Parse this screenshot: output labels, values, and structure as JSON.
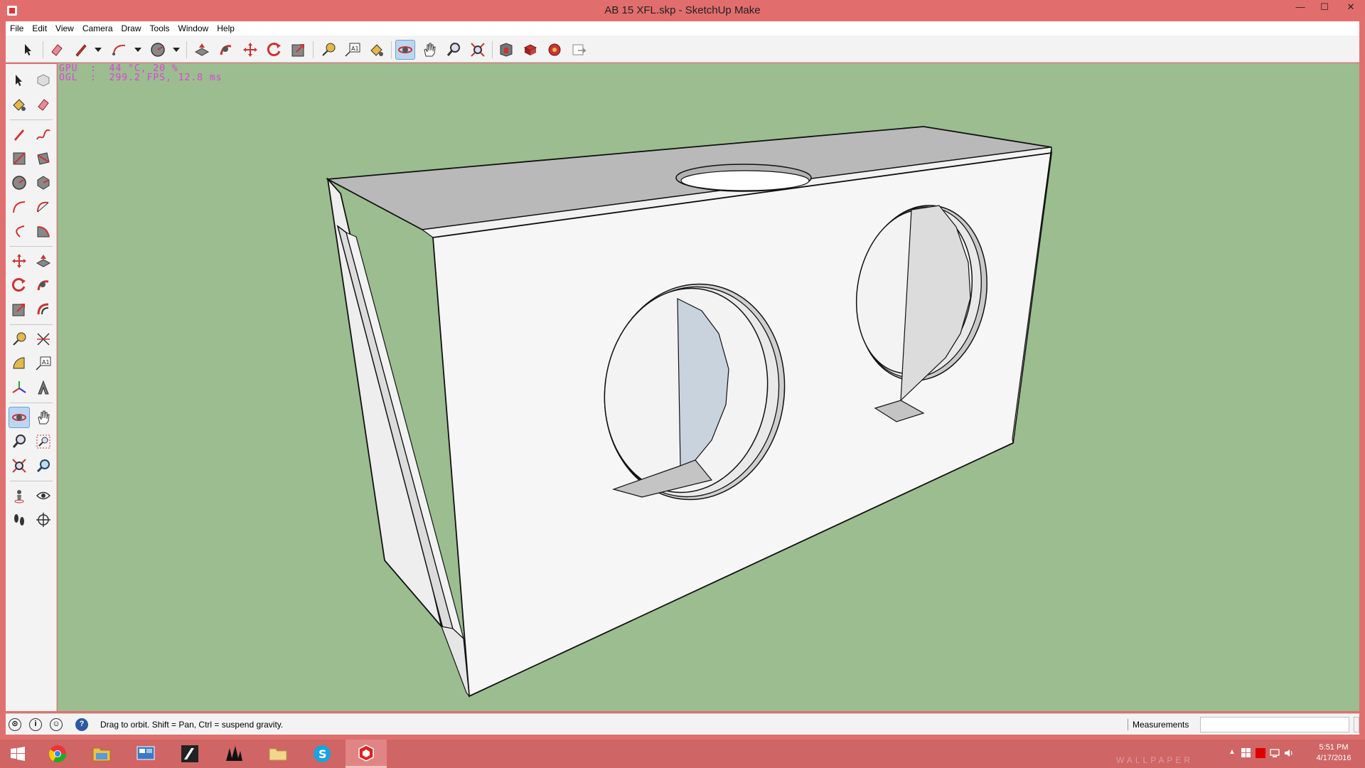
{
  "window": {
    "title": "AB 15 XFL.skp - SketchUp Make",
    "min_glyph": "—",
    "max_glyph": "☐",
    "close_glyph": "✕"
  },
  "menu": [
    "File",
    "Edit",
    "View",
    "Camera",
    "Draw",
    "Tools",
    "Window",
    "Help"
  ],
  "overlay": {
    "line1": "GPU  :  44 °C, 20 %",
    "line2": "OGL  :  299.2 FPS, 12.8 ms"
  },
  "top_toolbar_icons": [
    "select-icon",
    "eraser-icon",
    "pencil-icon",
    "dropdown-arrow-icon",
    "arc-icon",
    "dropdown-arrow-icon",
    "circle-icon",
    "dropdown-arrow-icon",
    "push-pull-icon",
    "follow-me-icon",
    "move-icon",
    "rotate-icon",
    "scale-icon",
    "tape-measure-icon",
    "text-icon",
    "paint-bucket-icon",
    "orbit-icon",
    "pan-icon",
    "zoom-icon",
    "zoom-extents-icon",
    "3d-warehouse-icon",
    "extension-warehouse-icon",
    "layout-icon",
    "send-to-layout-icon"
  ],
  "left_toolbar_icons": [
    "select-icon",
    "make-component-icon",
    "paint-bucket-icon",
    "eraser-icon",
    "pencil-icon",
    "freehand-icon",
    "rectangle-icon",
    "rotated-rectangle-icon",
    "circle-icon",
    "polygon-icon",
    "arc-icon",
    "two-point-arc-icon",
    "three-point-arc-icon",
    "pie-icon",
    "move-icon",
    "push-pull-icon",
    "rotate-icon",
    "follow-me-icon",
    "scale-icon",
    "offset-icon",
    "tape-measure-icon",
    "dimension-icon",
    "protractor-icon",
    "text-icon",
    "axes-icon",
    "3d-text-icon",
    "orbit-icon",
    "pan-icon",
    "zoom-icon",
    "zoom-window-icon",
    "zoom-extents-icon",
    "previous-view-icon",
    "position-camera-icon",
    "look-around-icon",
    "walk-icon",
    "section-plane-icon"
  ],
  "model": {
    "fill_top": "#b8b8b8",
    "fill_front": "#f6f6f6",
    "fill_side": "#ececec",
    "edge": "#111111"
  },
  "status": {
    "text": "Drag to orbit. Shift = Pan, Ctrl = suspend gravity.",
    "measurements_label": "Measurements",
    "measurements_value": ""
  },
  "taskbar": {
    "apps": [
      "start-icon",
      "chrome-icon",
      "file-explorer-icon",
      "control-panel-icon",
      "media-app-icon",
      "corsair-icon",
      "folder-icon",
      "skype-icon",
      "sketchup-icon"
    ],
    "active_app": "sketchup-icon",
    "time": "5:51 PM",
    "date": "4/17/2016",
    "watermark": "WALLPAPER"
  }
}
